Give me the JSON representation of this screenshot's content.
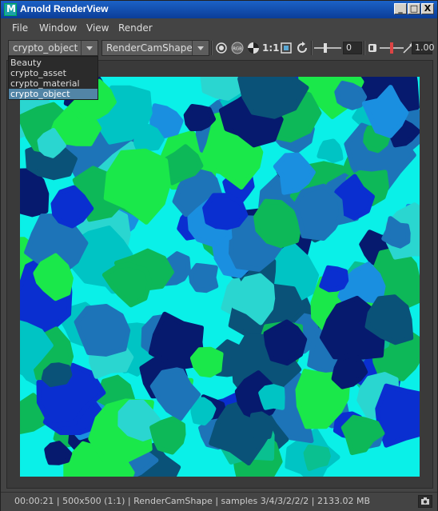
{
  "window": {
    "title": "Arnold RenderView",
    "icon": "maya-m-icon",
    "controls": {
      "minimize": "_",
      "maximize": "□",
      "close": "X"
    }
  },
  "menubar": {
    "items": [
      "File",
      "Window",
      "View",
      "Render"
    ]
  },
  "toolbar": {
    "aov_value": "crypto_object",
    "camera_value": "RenderCamShape",
    "ratio_label": "1:1",
    "exposure_value": "0",
    "gamma_value": "1.00",
    "icons": [
      "render-settings-icon",
      "rgb-icon",
      "checker-icon",
      "ratio-icon",
      "region-icon",
      "refresh-icon",
      "exposure-slider-icon",
      "snapshot-icon",
      "gamma-slider-icon",
      "wand-icon"
    ]
  },
  "aov_dropdown": {
    "options": [
      "Beauty",
      "crypto_asset",
      "crypto_material",
      "crypto_object"
    ],
    "selected_index": 3
  },
  "statusbar": {
    "text": "00:00:21 | 500x500 (1:1) | RenderCamShape  | samples 3/4/3/2/2/2 | 2133.02 MB",
    "icon": "camera-snapshot-icon"
  },
  "colors": {
    "selection": "#5285a6",
    "render_background": "#00ffff",
    "cells": [
      "#00c4c4",
      "#1a8fe0",
      "#0a2fd0",
      "#0a5278",
      "#1d74b8",
      "#0ac090",
      "#1ae84a",
      "#2ad6d0",
      "#061a6e",
      "#0db858"
    ]
  }
}
